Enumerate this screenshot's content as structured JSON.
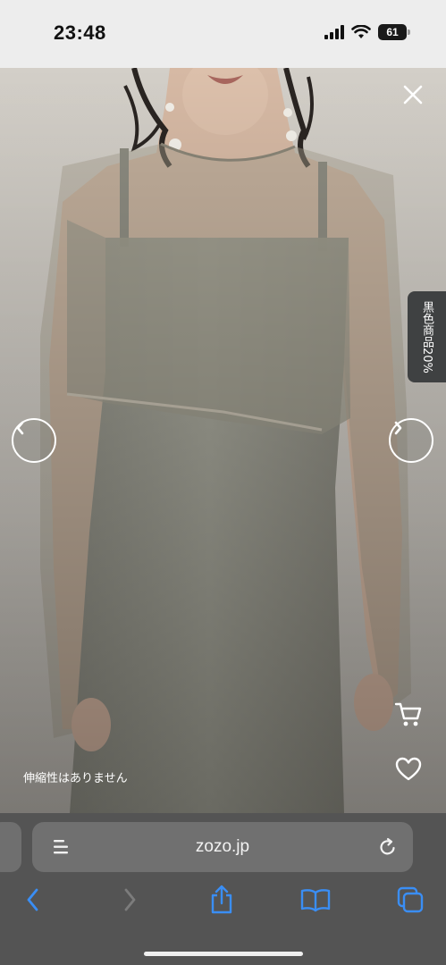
{
  "status_bar": {
    "time": "23:48",
    "battery_level": "61",
    "icons": [
      "signal-icon",
      "wifi-icon",
      "battery-icon"
    ]
  },
  "viewer": {
    "close_icon": "close-icon",
    "prev_icon": "chevron-left-icon",
    "next_icon": "chevron-right-icon",
    "promo_label": "黒色商品20%",
    "cart_icon": "cart-icon",
    "favorite_icon": "heart-icon",
    "caption": "伸縮性はありません"
  },
  "browser": {
    "url": "zozo.jp",
    "reader_icon": "page-menu-icon",
    "reload_icon": "reload-icon",
    "toolbar": [
      "back-icon",
      "forward-icon",
      "share-icon",
      "bookmarks-icon",
      "tabs-icon"
    ]
  },
  "colors": {
    "ios_blue": "#3a8ef5",
    "toolbar_bg": "#545454",
    "address_bar_bg": "#707070",
    "promo_bg": "#3f4142"
  }
}
